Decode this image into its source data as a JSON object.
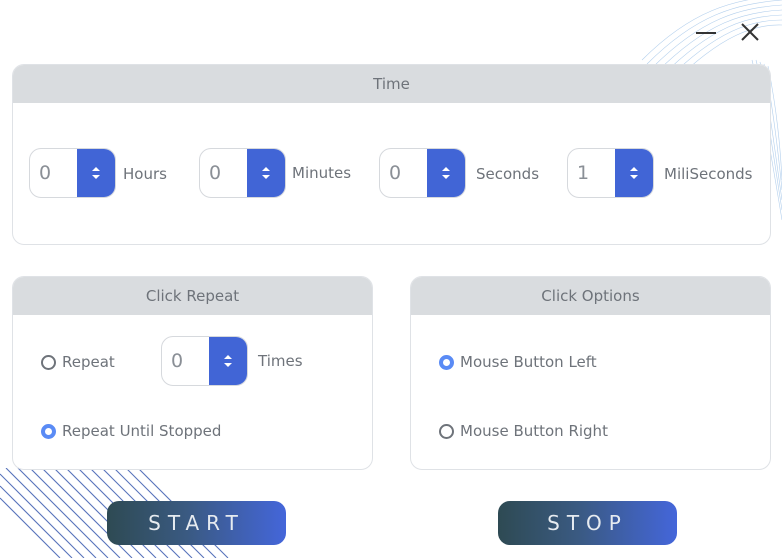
{
  "window": {
    "minimize_icon": "minimize-icon",
    "close_icon": "close-icon"
  },
  "time_panel": {
    "title": "Time",
    "fields": [
      {
        "value": "0",
        "unit": "Hours"
      },
      {
        "value": "0",
        "unit": "Minutes"
      },
      {
        "value": "0",
        "unit": "Seconds"
      },
      {
        "value": "1",
        "unit": "MiliSeconds"
      }
    ]
  },
  "repeat_panel": {
    "title": "Click Repeat",
    "repeat_label": "Repeat",
    "times_value": "0",
    "times_label": "Times",
    "until_stopped_label": "Repeat Until Stopped",
    "selected": "Repeat Until Stopped"
  },
  "options_panel": {
    "title": "Click Options",
    "left_label": "Mouse Button Left",
    "right_label": "Mouse Button Right",
    "selected": "Mouse Button Left"
  },
  "actions": {
    "start_label": "START",
    "stop_label": "STOP"
  },
  "colors": {
    "accent": "#4165d6",
    "radio_checked": "#5a8bf5",
    "header_bg": "#d9dcdf"
  }
}
